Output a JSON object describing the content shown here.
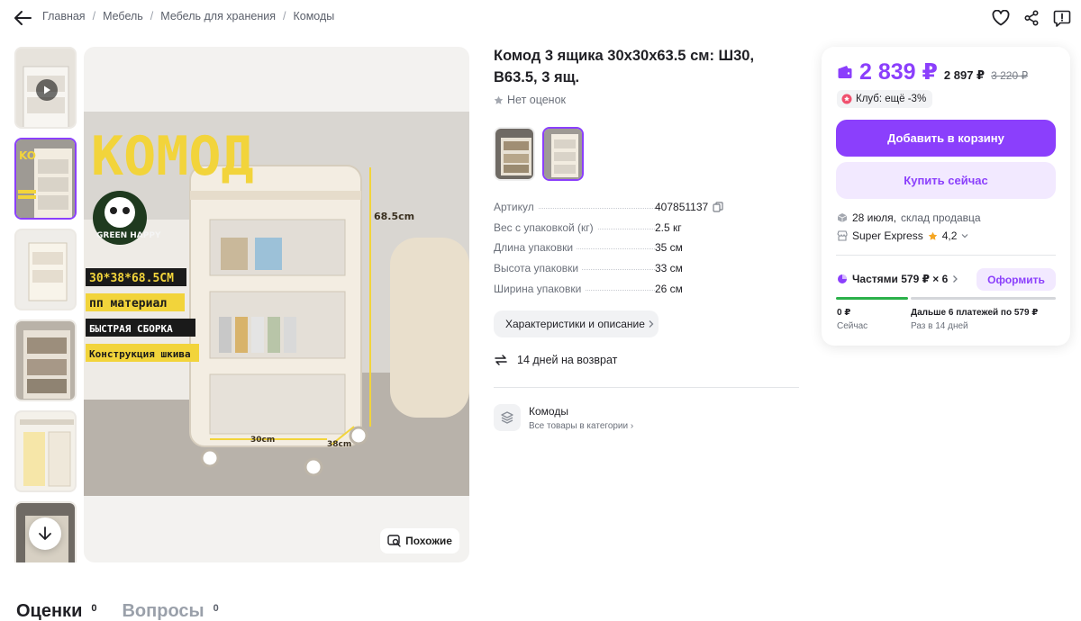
{
  "breadcrumb": [
    "Главная",
    "Мебель",
    "Мебель для хранения",
    "Комоды"
  ],
  "product": {
    "title": "Комод 3 ящика 30х30х63.5 см: Ш30, В63.5, 3 ящ.",
    "rating_text": "Нет оценок",
    "similar_label": "Похожие",
    "photo_texts": {
      "brand_logo": "GREEN HAPPY",
      "heading": "КОМОД",
      "lines": [
        "30*38*68.5CM",
        "пп материал",
        "БЫСТРАЯ СБОРКА",
        "Конструкция шкива"
      ],
      "dim_height": "68.5cm",
      "dim_width": "30cm",
      "dim_depth": "38cm"
    }
  },
  "specs": [
    {
      "name": "Артикул",
      "value": "407851137"
    },
    {
      "name": "Вес с упаковкой (кг)",
      "value": "2.5 кг"
    },
    {
      "name": "Длина упаковки",
      "value": "35 см"
    },
    {
      "name": "Высота упаковки",
      "value": "33 см"
    },
    {
      "name": "Ширина упаковки",
      "value": "26 см"
    }
  ],
  "characteristics_button": "Характеристики и описание",
  "return_text": "14 дней на возврат",
  "category": {
    "title": "Комоды",
    "subtitle": "Все товары в категории"
  },
  "price": {
    "main": "2 839 ₽",
    "second": "2 897 ₽",
    "old": "3 220 ₽",
    "club": "Клуб: ещё -3%"
  },
  "buttons": {
    "add_to_cart": "Добавить в корзину",
    "buy_now": "Купить сейчас",
    "checkout": "Оформить"
  },
  "delivery": {
    "date": "28 июля,",
    "source": "склад продавца",
    "express": "Super Express",
    "express_rating": "4,2"
  },
  "installments": {
    "label": "Частями 579 ₽ × 6",
    "first_amount": "0 ₽",
    "first_when": "Сейчас",
    "rest_amount": "Дальше 6 платежей по 579 ₽",
    "rest_when": "Раз в 14 дней"
  },
  "tabs": [
    {
      "label": "Оценки",
      "count": "0"
    },
    {
      "label": "Вопросы",
      "count": "0"
    }
  ],
  "colors": {
    "accent": "#8b3ffc",
    "accent_light": "#f2e9ff",
    "green": "#2bb14a"
  }
}
